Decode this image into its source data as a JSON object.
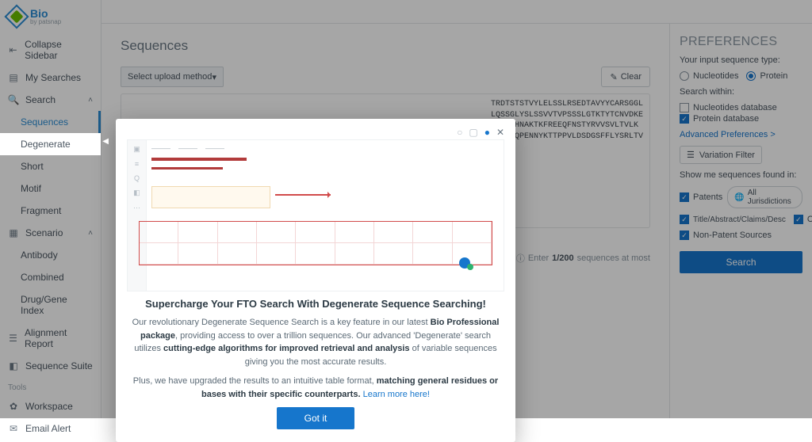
{
  "brand": {
    "title": "Bio",
    "subtitle": "by patsnap"
  },
  "sidebar": {
    "collapse": "Collapse Sidebar",
    "mySearches": "My Searches",
    "search": "Search",
    "searchItems": [
      "Sequences",
      "Degenerate",
      "Short",
      "Motif",
      "Fragment"
    ],
    "scenario": "Scenario",
    "scenarioItems": [
      "Antibody",
      "Combined",
      "Drug/Gene Index"
    ],
    "alignmentReport": "Alignment Report",
    "sequenceSuite": "Sequence Suite",
    "toolsLabel": "Tools",
    "workspace": "Workspace",
    "emailAlert": "Email Alert"
  },
  "page": {
    "title": "Sequences",
    "uploadPlaceholder": "Select upload method",
    "clear": "Clear",
    "seqText": "TRDTSTSTVYLELSSLRSEDTAVYYCARSGGL\nLQSSGLYSLSSVVTVPSSSLGTKTYTCNVDKE\nVDVEVHNAKTKFREEQFNSTYRVVSVLTVLK\nMESNGQPENNYKTTPPVLDSDGSFFLYSRLTV",
    "hintPrefix": "Enter ",
    "hintCount": "1/200",
    "hintSuffix": " sequences at most"
  },
  "prefs": {
    "title": "PREFERENCES",
    "inputTypeLabel": "Your input sequence type:",
    "nucleotides": "Nucleotides",
    "protein": "Protein",
    "searchWithin": "Search within:",
    "nucDb": "Nucleotides database",
    "protDb": "Protein database",
    "advLink": "Advanced Preferences >",
    "varFilter": "Variation Filter",
    "showMe": "Show me sequences found in:",
    "patents": "Patents",
    "allJur": "All Jurisdictions",
    "tacd": "Title/Abstract/Claims/Desc",
    "claims": "Claims",
    "nonPatent": "Non-Patent Sources",
    "searchBtn": "Search"
  },
  "modal": {
    "heading": "Supercharge Your FTO Search With Degenerate Sequence Searching!",
    "p1_a": "Our revolutionary Degenerate Sequence Search is a key feature in our latest ",
    "p1_b": "Bio Professional package",
    "p1_c": ", providing access to over a trillion sequences. Our advanced 'Degenerate' search utilizes ",
    "p1_d": "cutting-edge algorithms for improved retrieval and analysis",
    "p1_e": " of variable sequences giving you the most accurate results.",
    "p2_a": "Plus, we have upgraded the results to an intuitive table format, ",
    "p2_b": "matching general residues or bases with their specific counterparts.",
    "p2_link": " Learn more here!",
    "gotIt": "Got it"
  }
}
